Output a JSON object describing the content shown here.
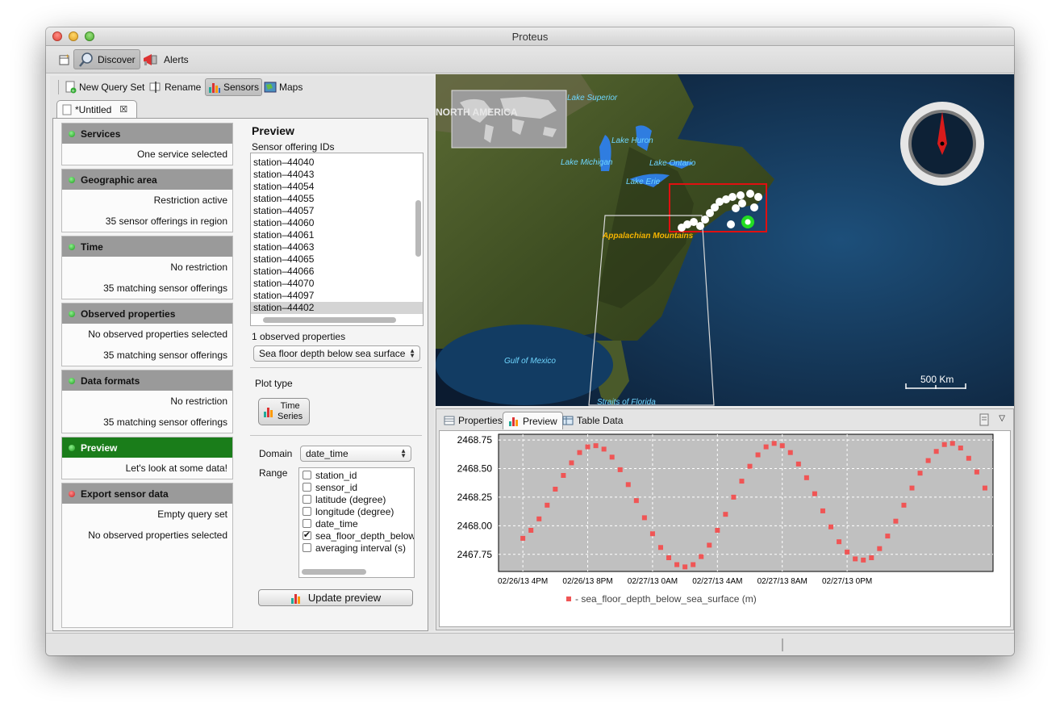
{
  "window": {
    "title": "Proteus"
  },
  "main_toolbar": {
    "items": [
      {
        "label": "Discover"
      },
      {
        "label": "Alerts"
      }
    ]
  },
  "sub_toolbar": {
    "items": [
      {
        "label": "New Query Set"
      },
      {
        "label": "Rename"
      },
      {
        "label": "Sensors"
      },
      {
        "label": "Maps"
      }
    ]
  },
  "editor_tab": {
    "label": "*Untitled"
  },
  "steps": [
    {
      "title": "Services",
      "status": "green",
      "lines": [
        "One service selected"
      ]
    },
    {
      "title": "Geographic area",
      "status": "green",
      "lines": [
        "Restriction active",
        "35 sensor offerings in region"
      ]
    },
    {
      "title": "Time",
      "status": "green",
      "lines": [
        "No restriction",
        "35 matching sensor offerings"
      ]
    },
    {
      "title": "Observed properties",
      "status": "green",
      "lines": [
        "No observed properties selected",
        "35 matching sensor offerings"
      ]
    },
    {
      "title": "Data formats",
      "status": "green",
      "lines": [
        "No restriction",
        "35 matching sensor offerings"
      ]
    },
    {
      "title": "Preview",
      "status": "green",
      "lines": [
        "Let's look at some data!"
      ]
    },
    {
      "title": "Export sensor data",
      "status": "red",
      "lines": [
        "Empty query set",
        "No observed properties selected"
      ]
    }
  ],
  "preview": {
    "title": "Preview",
    "offering_ids_label": "Sensor offering IDs",
    "offering_ids": [
      "station–44040",
      "station–44043",
      "station–44054",
      "station–44055",
      "station–44057",
      "station–44060",
      "station–44061",
      "station–44063",
      "station–44065",
      "station–44066",
      "station–44070",
      "station–44097",
      "station–44402"
    ],
    "selected_offering": "station–44402",
    "observed_count_label": "1 observed properties",
    "observed_property": "Sea floor depth below sea surface",
    "plot_type_label": "Plot type",
    "plot_type_button": {
      "line1": "Time",
      "line2": "Series"
    },
    "domain_label": "Domain",
    "domain_value": "date_time",
    "range_label": "Range",
    "range_items": [
      {
        "label": "station_id",
        "checked": false
      },
      {
        "label": "sensor_id",
        "checked": false
      },
      {
        "label": "latitude (degree)",
        "checked": false
      },
      {
        "label": "longitude (degree)",
        "checked": false
      },
      {
        "label": "date_time",
        "checked": false
      },
      {
        "label": "sea_floor_depth_below",
        "checked": true
      },
      {
        "label": "averaging interval (s)",
        "checked": false
      }
    ],
    "update_button": "Update preview"
  },
  "map": {
    "labels": {
      "north_america": "NORTH AMERICA",
      "lake_superior": "Lake Superior",
      "lake_huron": "Lake Huron",
      "lake_michigan": "Lake Michigan",
      "lake_ontario": "Lake Ontario",
      "lake_erie": "Lake Erie",
      "appalachian": "Appalachian Mountains",
      "gulf_mexico": "Gulf of Mexico",
      "straits_florida": "Straits of Florida"
    },
    "scale_label": "500 Km"
  },
  "bottom_tabs": [
    {
      "label": "Properties"
    },
    {
      "label": "Preview"
    },
    {
      "label": "Table Data"
    }
  ],
  "chart_data": {
    "type": "line",
    "title": "",
    "xlabel": "",
    "ylabel": "",
    "x_ticks": [
      "02/26/13 4PM",
      "02/26/13 8PM",
      "02/27/13 0AM",
      "02/27/13 4AM",
      "02/27/13 8AM",
      "02/27/13 0PM"
    ],
    "y_ticks": [
      "2468.75",
      "2468.50",
      "2468.25",
      "2468.00",
      "2467.75"
    ],
    "ylim": [
      2467.6,
      2468.8
    ],
    "xlim_hours": [
      14.5,
      45
    ],
    "grid": true,
    "legend_position": "bottom",
    "series": [
      {
        "name": "sea_floor_depth_below_sea_surface (m)",
        "color": "#f05555",
        "x": [
          16.0,
          16.5,
          17.0,
          17.5,
          18.0,
          18.5,
          19.0,
          19.5,
          20.0,
          20.5,
          21.0,
          21.5,
          22.0,
          22.5,
          23.0,
          23.5,
          24.0,
          24.5,
          25.0,
          25.5,
          26.0,
          26.5,
          27.0,
          27.5,
          28.0,
          28.5,
          29.0,
          29.5,
          30.0,
          30.5,
          31.0,
          31.5,
          32.0,
          32.5,
          33.0,
          33.5,
          34.0,
          34.5,
          35.0,
          35.5,
          36.0,
          36.5,
          37.0,
          37.5,
          38.0,
          38.5,
          39.0,
          39.5,
          40.0,
          40.5,
          41.0,
          41.5,
          42.0,
          42.5,
          43.0,
          43.5,
          44.0,
          44.5
        ],
        "values": [
          2467.89,
          2467.96,
          2468.06,
          2468.18,
          2468.32,
          2468.44,
          2468.55,
          2468.64,
          2468.69,
          2468.7,
          2468.67,
          2468.6,
          2468.49,
          2468.36,
          2468.22,
          2468.07,
          2467.93,
          2467.81,
          2467.72,
          2467.66,
          2467.64,
          2467.66,
          2467.73,
          2467.83,
          2467.96,
          2468.1,
          2468.25,
          2468.39,
          2468.52,
          2468.62,
          2468.69,
          2468.72,
          2468.7,
          2468.64,
          2468.54,
          2468.42,
          2468.28,
          2468.13,
          2467.99,
          2467.86,
          2467.77,
          2467.71,
          2467.7,
          2467.72,
          2467.8,
          2467.91,
          2468.04,
          2468.18,
          2468.33,
          2468.46,
          2468.57,
          2468.65,
          2468.71,
          2468.72,
          2468.68,
          2468.59,
          2468.47,
          2468.33
        ]
      }
    ]
  }
}
